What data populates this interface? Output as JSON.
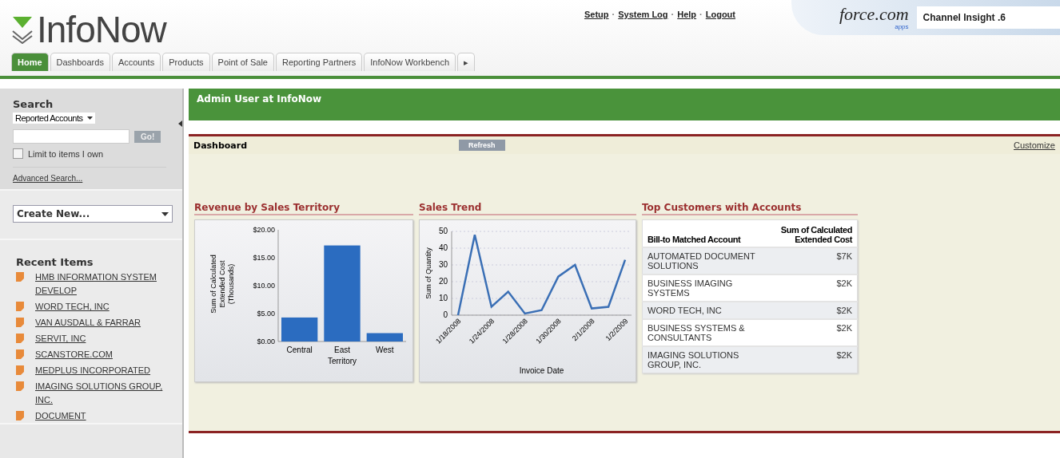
{
  "header": {
    "logo": "InfoNow",
    "links": [
      "Setup",
      "System Log",
      "Help",
      "Logout"
    ],
    "link_separator": "·",
    "platform_logo": {
      "name": "force.com",
      "sub": "apps"
    },
    "app_name": "Channel Insight .6"
  },
  "tabs": [
    {
      "label": "Home",
      "selected": true
    },
    {
      "label": "Dashboards",
      "selected": false
    },
    {
      "label": "Accounts",
      "selected": false
    },
    {
      "label": "Products",
      "selected": false
    },
    {
      "label": "Point of Sale",
      "selected": false
    },
    {
      "label": "Reporting Partners",
      "selected": false
    },
    {
      "label": "InfoNow Workbench",
      "selected": false
    },
    {
      "label": "▸",
      "selected": false
    }
  ],
  "sidebar": {
    "search": {
      "title": "Search",
      "scope": "Reported Accounts",
      "button": "Go!",
      "limit_label": "Limit to items I own",
      "limit_checked": false,
      "advanced": "Advanced Search..."
    },
    "create_new": "Create New...",
    "recent_title": "Recent Items",
    "recent_items": [
      "HMB INFORMATION SYSTEM DEVELOP",
      "WORD TECH, INC",
      "VAN AUSDALL & FARRAR",
      "SERVIT, INC",
      "SCANSTORE.COM",
      "MEDPLUS INCORPORATED",
      "IMAGING SOLUTIONS GROUP, INC.",
      "DOCUMENT"
    ]
  },
  "banner": "Admin User at InfoNow",
  "dashboard": {
    "title": "Dashboard",
    "refresh": "Refresh",
    "customize": "Customize",
    "components": [
      {
        "title": "Revenue by Sales Territory",
        "chart_data": {
          "type": "bar",
          "xlabel": "Territory",
          "ylabel": "Sum of Calculated Extended Cost (Thousands)",
          "categories": [
            "Central",
            "East",
            "West"
          ],
          "series": [
            {
              "color": "#2b6cc0",
              "values": [
                4.3,
                17.2,
                1.5
              ]
            }
          ],
          "ylim": [
            0,
            20
          ],
          "yticks": [
            {
              "value": 0,
              "label": "$0.00"
            },
            {
              "value": 5,
              "label": "$5.00"
            },
            {
              "value": 10,
              "label": "$10.00"
            },
            {
              "value": 15,
              "label": "$15.00"
            },
            {
              "value": 20,
              "label": "$20.00"
            }
          ]
        }
      },
      {
        "title": "Sales Trend",
        "chart_data": {
          "type": "line",
          "xlabel": "Invoice Date",
          "ylabel": "Sum of Quantity",
          "categories": [
            "1/18/2008",
            null,
            "1/24/2008",
            null,
            "1/28/2008",
            null,
            "1/30/2008",
            null,
            "2/1/2008",
            null,
            "1/2/2009"
          ],
          "series": [
            {
              "color": "#3a6fb5",
              "values": [
                0,
                48,
                5,
                14,
                1,
                3,
                23,
                30,
                4,
                5,
                33
              ]
            }
          ],
          "ylim": [
            0,
            50
          ],
          "yticks": [
            0,
            10,
            20,
            30,
            40,
            50
          ],
          "grid": true
        }
      },
      {
        "title": "Top Customers with Accounts",
        "table": {
          "columns": [
            "Bill-to Matched Account",
            "Sum of Calculated Extended Cost"
          ],
          "rows": [
            [
              "AUTOMATED DOCUMENT SOLUTIONS",
              "$7K"
            ],
            [
              "BUSINESS IMAGING SYSTEMS",
              "$2K"
            ],
            [
              "WORD TECH, INC",
              "$2K"
            ],
            [
              "BUSINESS SYSTEMS & CONSULTANTS",
              "$2K"
            ],
            [
              "IMAGING SOLUTIONS GROUP, INC.",
              "$2K"
            ]
          ]
        }
      }
    ]
  }
}
